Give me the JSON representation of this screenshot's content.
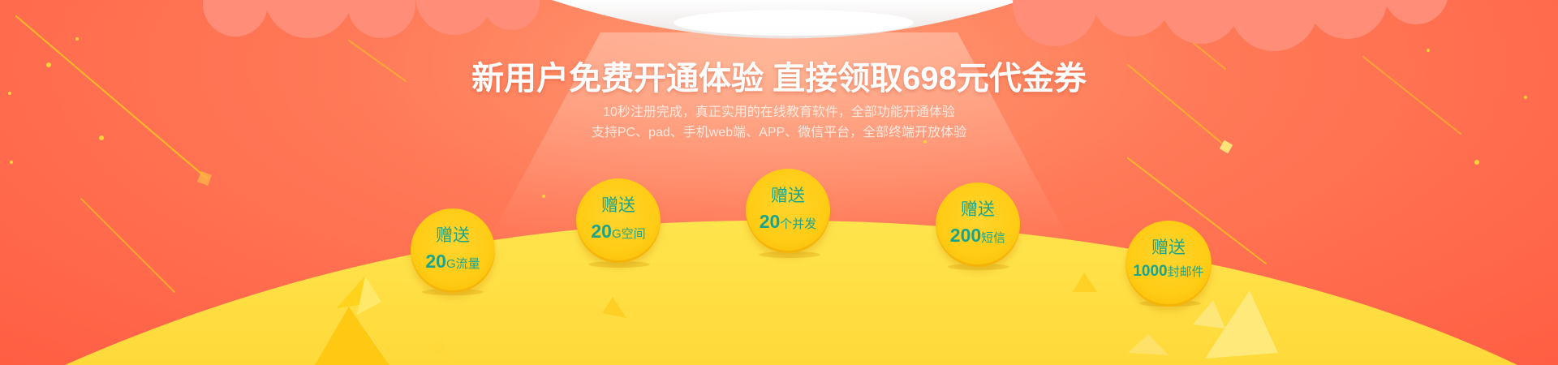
{
  "banner": {
    "headline": "新用户免费开通体验 直接领取698元代金券",
    "subtitle_line1": "10秒注册完成，真正实用的在线教育软件，全部功能开通体验",
    "subtitle_line2": "支持PC、pad、手机web端、APP、微信平台，全部终端开放体验"
  },
  "gifts": [
    {
      "label": "赠送",
      "number": "20",
      "unit": "G流量"
    },
    {
      "label": "赠送",
      "number": "20",
      "unit": "G空间"
    },
    {
      "label": "赠送",
      "number": "20",
      "unit": "个并发"
    },
    {
      "label": "赠送",
      "number": "200",
      "unit": "短信"
    },
    {
      "label": "赠送",
      "number": "1000",
      "unit": "封邮件"
    }
  ],
  "colors": {
    "background": "#ff6a4d",
    "cloud": "#ff8a74",
    "hill": "#ffe14d",
    "coin": "#ffcb14",
    "coin_text": "#1aa48d",
    "headline_text": "#ffffff"
  }
}
